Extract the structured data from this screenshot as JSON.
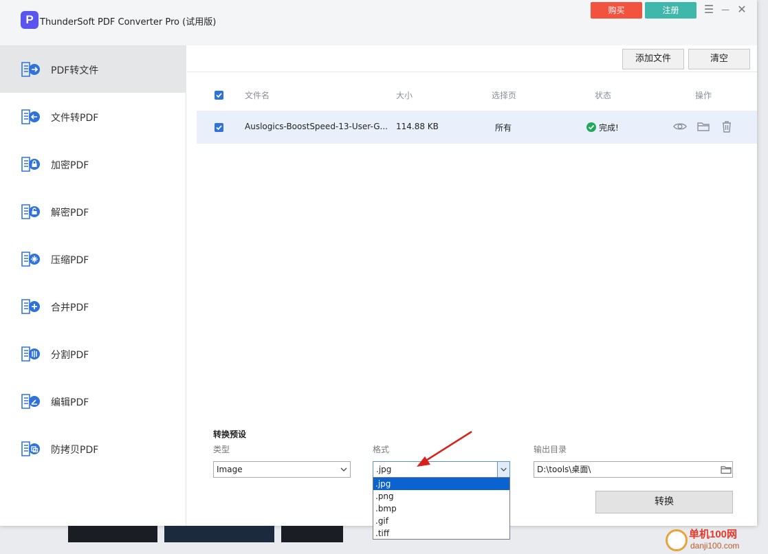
{
  "window": {
    "title": "ThunderSoft PDF Converter Pro (试用版)",
    "logo_letter": "P",
    "buy_label": "购买",
    "register_label": "注册",
    "menu_glyph": "☰",
    "min_glyph": "—",
    "close_glyph": "✕"
  },
  "sidebar": {
    "items": [
      {
        "label": "PDF转文件",
        "icon": "pdf-to-file-icon"
      },
      {
        "label": "文件转PDF",
        "icon": "file-to-pdf-icon"
      },
      {
        "label": "加密PDF",
        "icon": "encrypt-pdf-icon"
      },
      {
        "label": "解密PDF",
        "icon": "decrypt-pdf-icon"
      },
      {
        "label": "压缩PDF",
        "icon": "compress-pdf-icon"
      },
      {
        "label": "合并PDF",
        "icon": "merge-pdf-icon"
      },
      {
        "label": "分割PDF",
        "icon": "split-pdf-icon"
      },
      {
        "label": "编辑PDF",
        "icon": "edit-pdf-icon"
      },
      {
        "label": "防拷贝PDF",
        "icon": "copy-protect-pdf-icon"
      }
    ]
  },
  "toolbar": {
    "add_files": "添加文件",
    "clear": "清空"
  },
  "table": {
    "headers": {
      "filename": "文件名",
      "size": "大小",
      "pages": "选择页",
      "status": "状态",
      "actions": "操作"
    },
    "rows": [
      {
        "filename": "Auslogics-BoostSpeed-13-User-G...",
        "size": "114.88 KB",
        "pages": "所有",
        "status": "完成!"
      }
    ]
  },
  "preset": {
    "title": "转换预设",
    "type_label": "类型",
    "type_value": "Image",
    "format_label": "格式",
    "format_value": ".jpg",
    "format_options": [
      ".jpg",
      ".png",
      ".bmp",
      ".gif",
      ".tiff"
    ],
    "output_label": "输出目录",
    "output_value": "D:\\tools\\桌面\\",
    "convert_label": "转换"
  },
  "watermark": {
    "site_name": "单机100网",
    "site_url": "danji100.com"
  },
  "colors": {
    "accent": "#2f73d8",
    "buy": "#f2533f",
    "register": "#3fb8ab",
    "success": "#21a95b"
  }
}
